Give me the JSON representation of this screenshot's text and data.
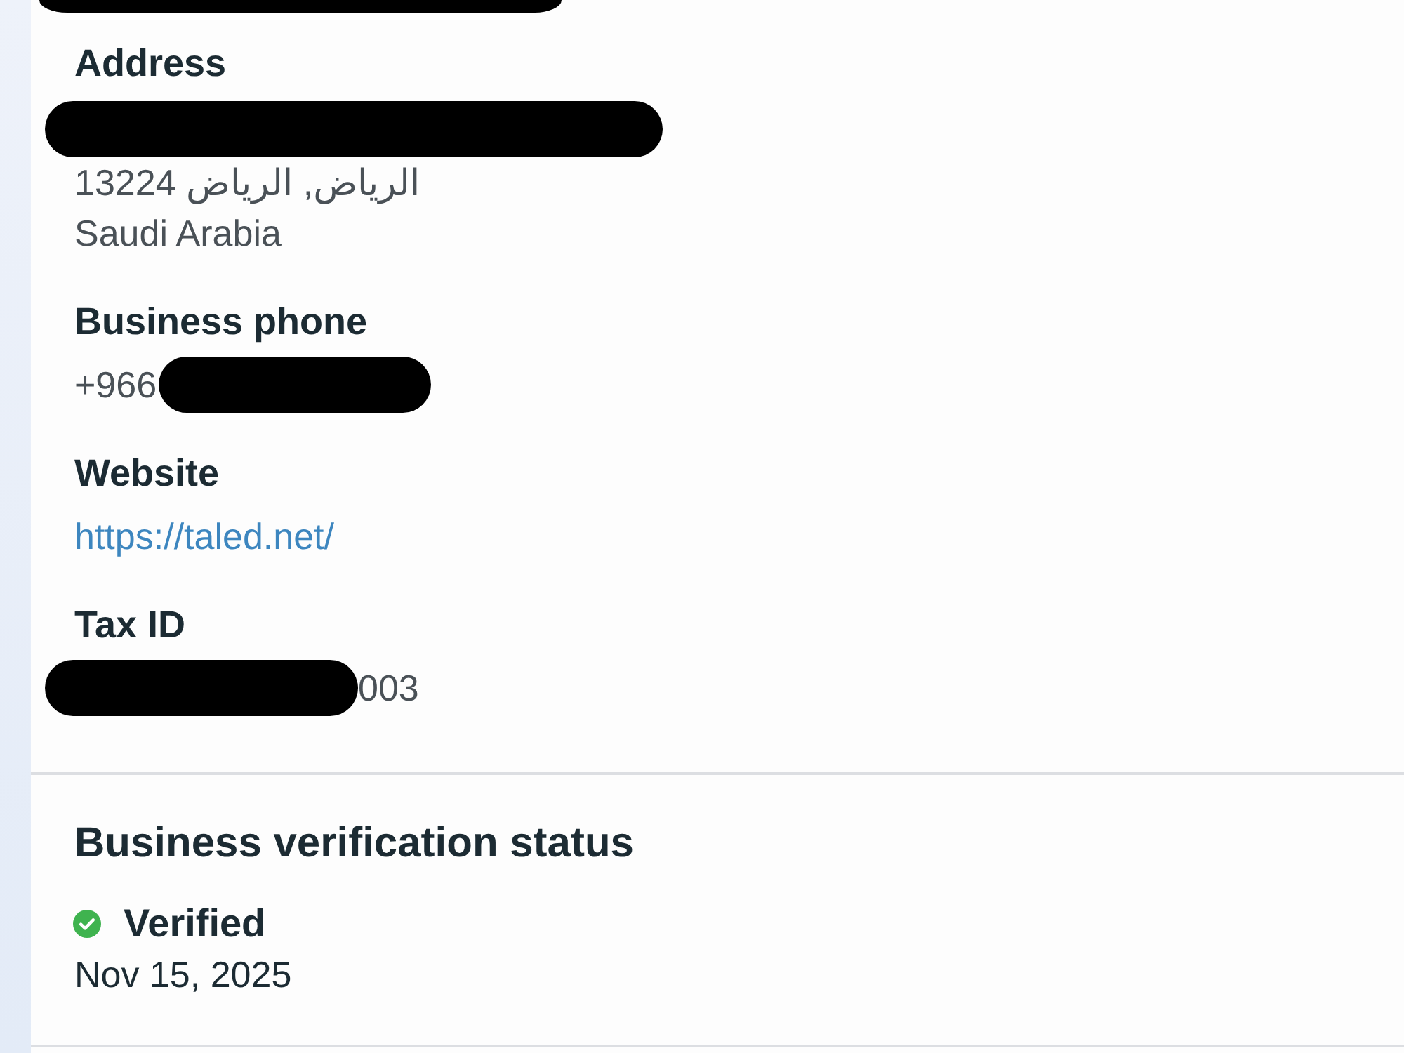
{
  "details": {
    "lines_above": [
      {
        "kind": "redacted"
      }
    ],
    "fields": [
      {
        "label": "Address",
        "lines": [
          {
            "kind": "redacted"
          },
          {
            "kind": "text",
            "text": "الرياض, الرياض 13224"
          },
          {
            "kind": "text",
            "text": "Saudi Arabia"
          }
        ]
      },
      {
        "label": "Business phone",
        "lines": [
          {
            "kind": "text",
            "text": "+966",
            "redacted_after": true
          }
        ]
      },
      {
        "label": "Website",
        "lines": [
          {
            "kind": "link",
            "text": "https://taled.net/"
          }
        ]
      },
      {
        "label": "Tax ID",
        "lines": [
          {
            "kind": "text",
            "text": "003",
            "redacted_before": true
          }
        ]
      }
    ]
  },
  "verification": {
    "title": "Business verification status",
    "status": {
      "label": "Verified",
      "verified": true
    },
    "date": "Nov 15, 2025"
  }
}
